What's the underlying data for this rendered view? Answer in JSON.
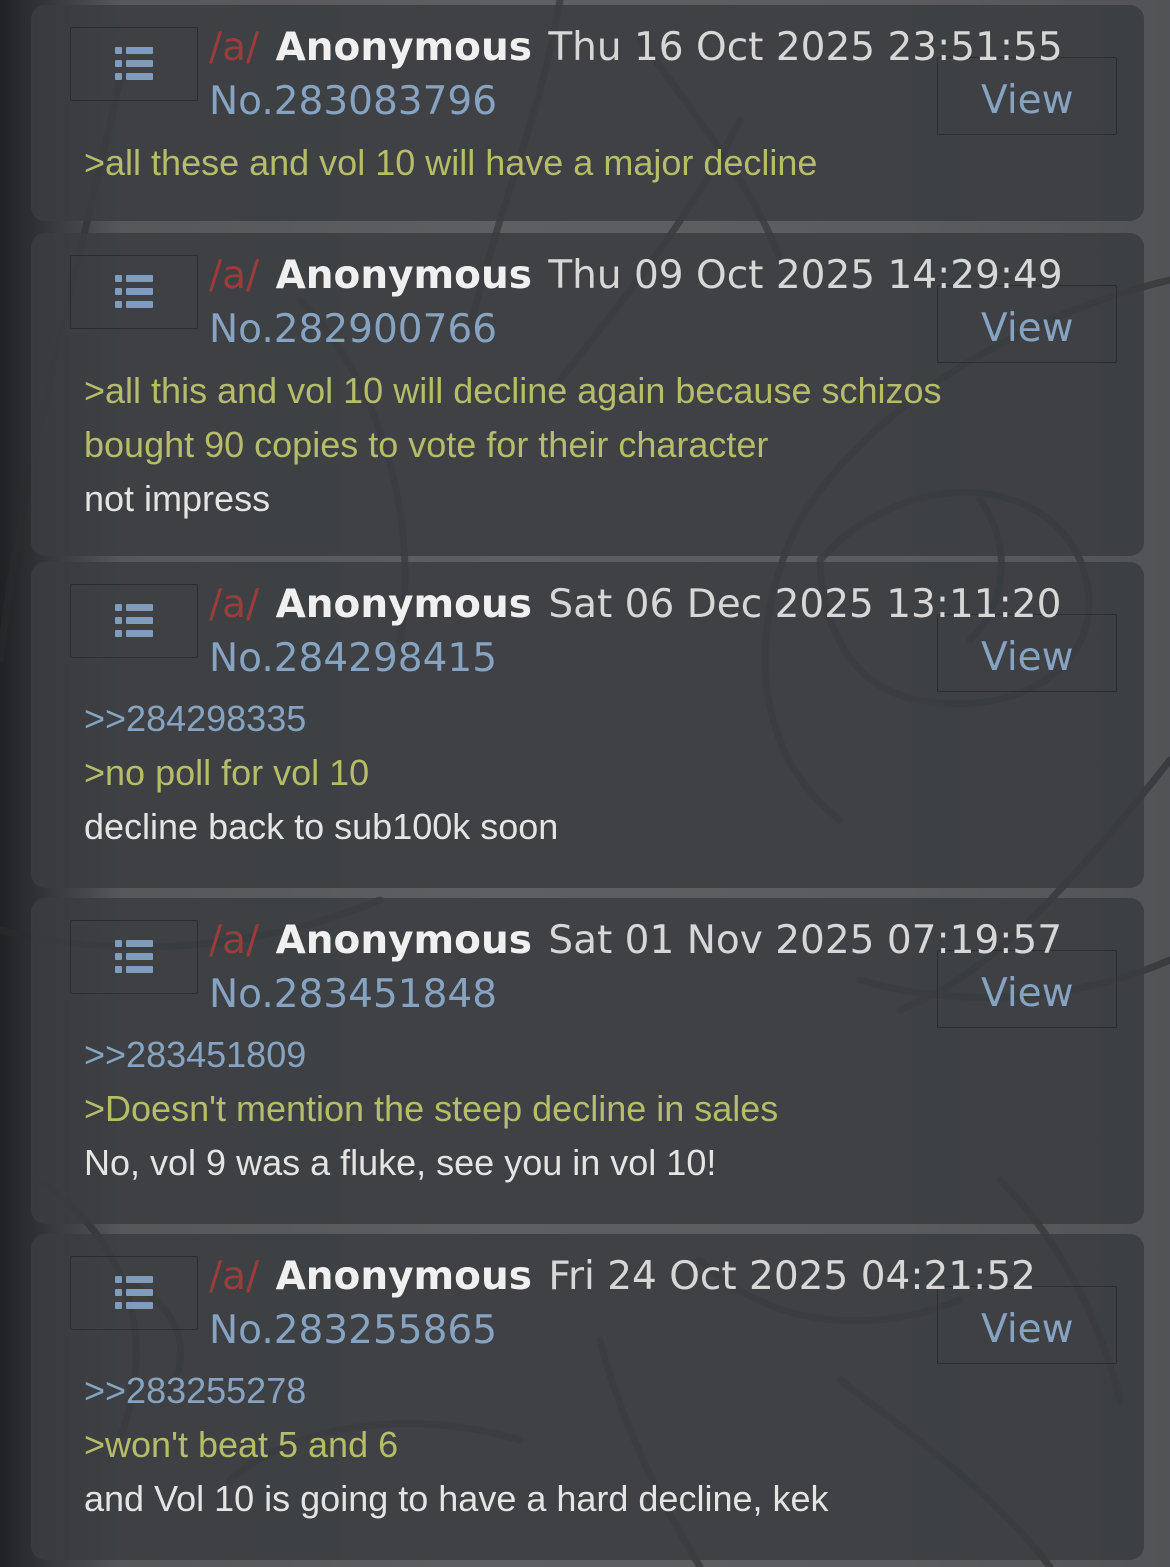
{
  "colors": {
    "board": "#9c3b3b",
    "name": "#f0f0f0",
    "link": "#86a3c1",
    "greentext": "#b5bd68",
    "text": "#e4e4e4",
    "card": "#3a3c40"
  },
  "icons": {
    "menu": "list-icon"
  },
  "posts": [
    {
      "board": "/a/",
      "name": "Anonymous",
      "date": "Thu 16 Oct 2025 23:51:55",
      "number": "No.283083796",
      "view": "View",
      "lines": [
        {
          "type": "quote",
          "text": ">all these and vol 10 will have a major decline"
        }
      ]
    },
    {
      "board": "/a/",
      "name": "Anonymous",
      "date": "Thu 09 Oct 2025 14:29:49",
      "number": "No.282900766",
      "view": "View",
      "lines": [
        {
          "type": "quote",
          "text": ">all this and vol 10 will decline again because schizos"
        },
        {
          "type": "quote",
          "text": "bought 90 copies to vote for their character"
        },
        {
          "type": "plain",
          "text": "not impress"
        }
      ]
    },
    {
      "board": "/a/",
      "name": "Anonymous",
      "date": "Sat 06 Dec 2025 13:11:20",
      "number": "No.284298415",
      "view": "View",
      "lines": [
        {
          "type": "reply",
          "text": ">>284298335"
        },
        {
          "type": "quote",
          "text": ">no poll for vol 10"
        },
        {
          "type": "plain",
          "text": "decline back to sub100k soon"
        }
      ]
    },
    {
      "board": "/a/",
      "name": "Anonymous",
      "date": "Sat 01 Nov 2025 07:19:57",
      "number": "No.283451848",
      "view": "View",
      "lines": [
        {
          "type": "reply",
          "text": ">>283451809"
        },
        {
          "type": "quote",
          "text": ">Doesn't mention the steep decline in sales"
        },
        {
          "type": "plain",
          "text": "No, vol 9 was a fluke, see you in vol 10!"
        }
      ]
    },
    {
      "board": "/a/",
      "name": "Anonymous",
      "date": "Fri 24 Oct 2025 04:21:52",
      "number": "No.283255865",
      "view": "View",
      "lines": [
        {
          "type": "reply",
          "text": ">>283255278"
        },
        {
          "type": "quote",
          "text": ">won't beat 5 and 6"
        },
        {
          "type": "plain",
          "text": "and Vol 10 is going to have a hard decline, kek"
        }
      ]
    }
  ]
}
